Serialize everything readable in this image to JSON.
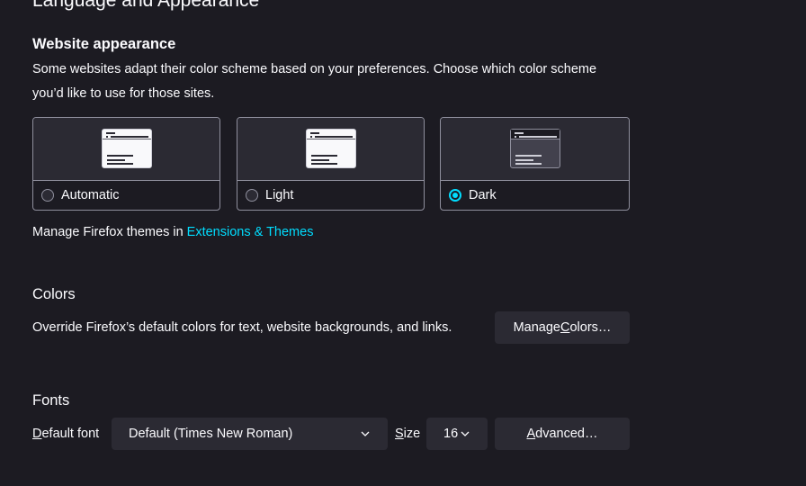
{
  "section": {
    "title": "Language and Appearance"
  },
  "website_appearance": {
    "heading": "Website appearance",
    "description_line1": "Some websites adapt their color scheme based on your preferences. Choose which color scheme",
    "description_line2": "you’d like to use for those sites.",
    "options": [
      {
        "label": "Automatic",
        "checked": false
      },
      {
        "label": "Light",
        "checked": false
      },
      {
        "label": "Dark",
        "checked": true
      }
    ],
    "manage_themes_prefix": "Manage Firefox themes in ",
    "manage_themes_link": "Extensions & Themes"
  },
  "colors": {
    "heading": "Colors",
    "description": "Override Firefox’s default colors for text, website backgrounds, and links.",
    "button_label_pre": "Manage ",
    "button_label_accel": "C",
    "button_label_post": "olors…"
  },
  "fonts": {
    "heading": "Fonts",
    "default_font_label_accel": "D",
    "default_font_label_rest": "efault font",
    "default_font_value": "Default (Times New Roman)",
    "size_label_accel": "S",
    "size_label_rest": "ize",
    "size_value": "16",
    "advanced_label_accel": "A",
    "advanced_label_rest": "dvanced…"
  },
  "icons": {
    "dropdown": "chevron-down-icon",
    "radio": "radio-icon",
    "theme_preview": "browser-window-icon"
  },
  "colors_palette": {
    "accent": "#00ddff",
    "background": "#1c1b22",
    "surface": "#2b2a33",
    "border": "#8f8f9d"
  }
}
